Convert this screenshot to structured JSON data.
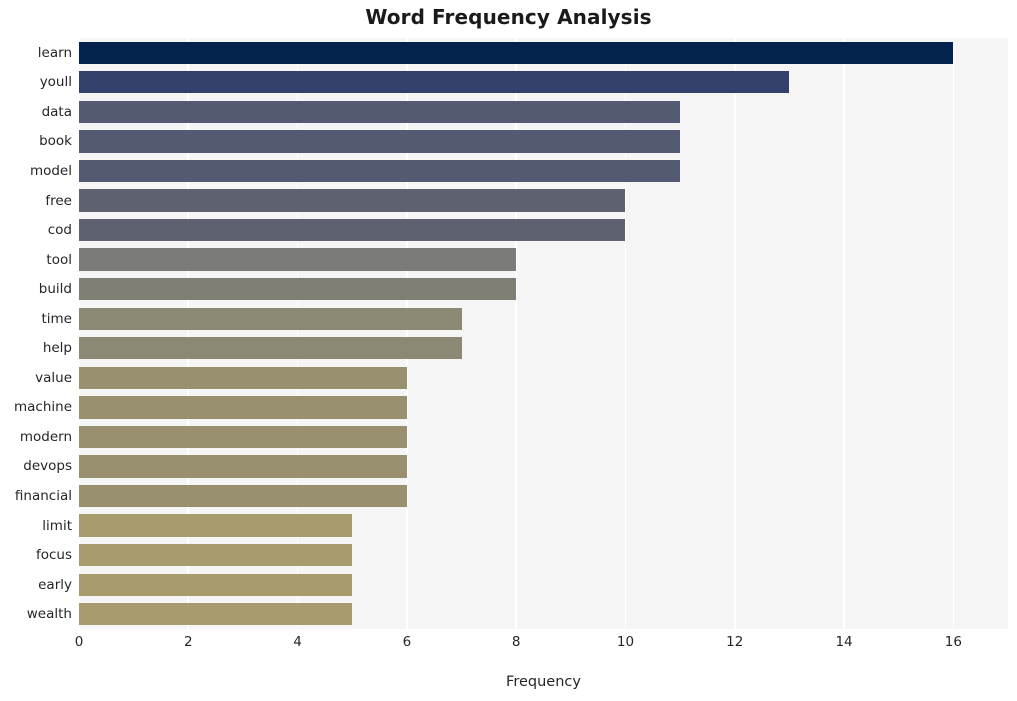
{
  "chart_data": {
    "type": "bar",
    "orientation": "horizontal",
    "title": "Word Frequency Analysis",
    "xlabel": "Frequency",
    "ylabel": "",
    "xlim": [
      0,
      17
    ],
    "ylim": [
      0,
      20
    ],
    "xticks": [
      0,
      2,
      4,
      6,
      8,
      10,
      12,
      14,
      16
    ],
    "xtick_labels": [
      "0",
      "2",
      "4",
      "6",
      "8",
      "10",
      "12",
      "14",
      "16"
    ],
    "grid": "x-only-white-on-gray",
    "legend": "none",
    "style": "whitegrid",
    "categories": [
      "learn",
      "youll",
      "data",
      "book",
      "model",
      "free",
      "cod",
      "tool",
      "build",
      "time",
      "help",
      "value",
      "machine",
      "modern",
      "devops",
      "financial",
      "limit",
      "focus",
      "early",
      "wealth"
    ],
    "values": [
      16,
      13,
      11,
      11,
      11,
      10,
      10,
      8,
      8,
      7,
      7,
      6,
      6,
      6,
      6,
      6,
      5,
      5,
      5,
      5
    ],
    "bar_colors": [
      "#04234c",
      "#32406b",
      "#545a72",
      "#545a72",
      "#545a72",
      "#5e6270",
      "#5e6270",
      "#7b7b79",
      "#7f7e74",
      "#8b8874",
      "#8b8874",
      "#99906f",
      "#99906f",
      "#99906f",
      "#99906f",
      "#99906f",
      "#a89c6e",
      "#a89c6e",
      "#a89c6e",
      "#a89c6e"
    ],
    "colors": {
      "plot_background": "#f5f5f6",
      "figure_background": "#ffffff",
      "gridline": "#ffffff",
      "text": "#262626",
      "title": "#1a1a1a"
    }
  }
}
